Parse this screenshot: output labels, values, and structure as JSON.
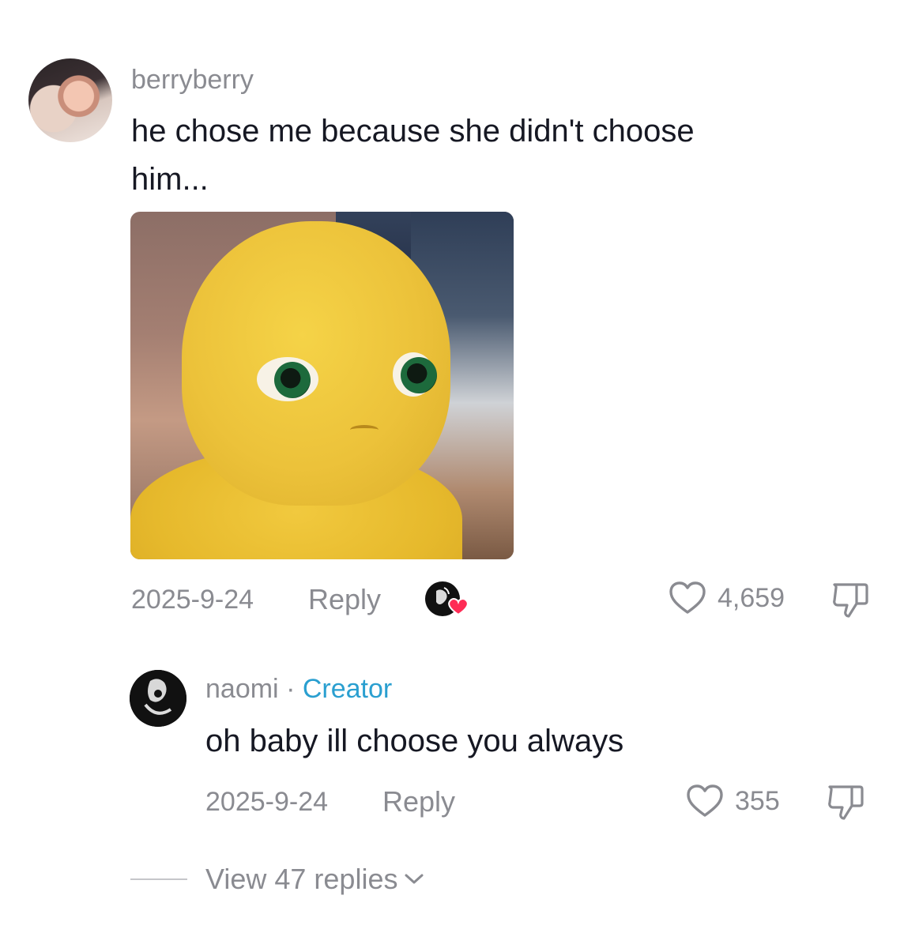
{
  "comment": {
    "username": "berryberry",
    "text_line1": "he chose me because she didn't choose",
    "text_line2": "him...",
    "date": "2025-9-24",
    "reply_label": "Reply",
    "like_count": "4,659",
    "creator_liked": true
  },
  "reply": {
    "username": "naomi",
    "separator": "·",
    "creator_label": "Creator",
    "text": "oh baby ill choose you always",
    "date": "2025-9-24",
    "reply_label": "Reply",
    "like_count": "355"
  },
  "view_replies_label": "View 47 replies",
  "icons": {
    "like": "heart-outline-icon",
    "dislike": "thumbs-down-icon",
    "expand": "chevron-down-icon",
    "creator_like_badge": "creator-liked-heart-icon"
  },
  "colors": {
    "text_primary": "#161823",
    "text_secondary": "#8a8b91",
    "creator_tag": "#2a9fd0",
    "heart_badge": "#fe2c55"
  }
}
